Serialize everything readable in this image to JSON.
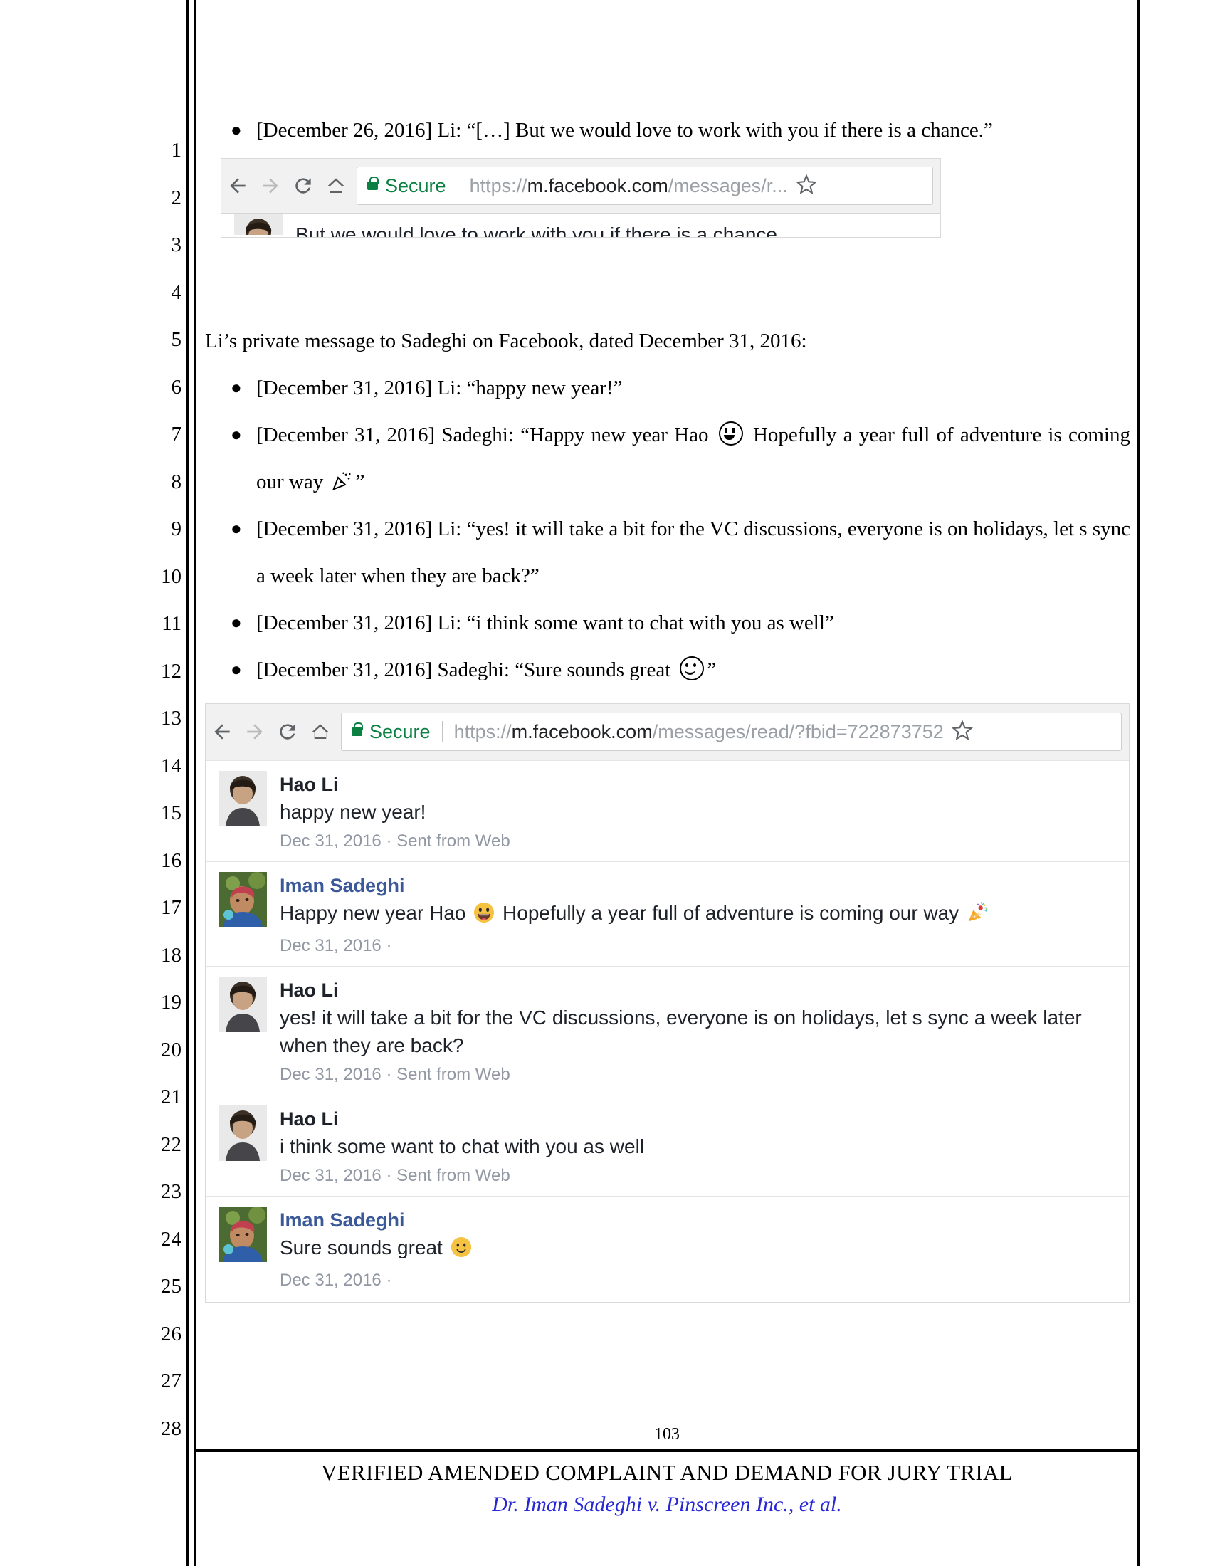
{
  "document": {
    "line_numbers": [
      "1",
      "2",
      "3",
      "4",
      "5",
      "6",
      "7",
      "8",
      "9",
      "10",
      "11",
      "12",
      "13",
      "14",
      "15",
      "16",
      "17",
      "18",
      "19",
      "20",
      "21",
      "22",
      "23",
      "24",
      "25",
      "26",
      "27",
      "28"
    ],
    "footer": {
      "page_number": "103",
      "title": "VERIFIED AMENDED COMPLAINT AND DEMAND FOR JURY TRIAL",
      "case_caption": "Dr. Iman Sadeghi v. Pinscreen Inc., et al."
    }
  },
  "body": {
    "bullet_dec26": "[December 26, 2016] Li: “[…] But we would love to work with you if there is a chance.”",
    "intro_paragraph": "Li’s private message to Sadeghi on Facebook, dated December 31, 2016:",
    "bullets": [
      {
        "pre": "[December 31, 2016] Li: “happy new year!”",
        "post": ""
      },
      {
        "pre": "[December 31, 2016] Sadeghi: “Happy new year Hao ",
        "mid": " Hopefully a year full of adventure is coming our way ",
        "post": "”"
      },
      {
        "pre": "[December 31, 2016] Li: “yes! it will take a bit for the VC discussions, everyone is on holidays, let s sync a week later when they are back?”",
        "post": ""
      },
      {
        "pre": "[December 31, 2016] Li: “i think some want to chat with you as well”",
        "post": ""
      },
      {
        "pre": "[December 31, 2016] Sadeghi: “Sure sounds great ",
        "post": "”"
      }
    ]
  },
  "screenshot_one": {
    "browser": {
      "back_icon": "back-arrow-icon",
      "forward_icon": "forward-arrow-icon",
      "reload_icon": "reload-icon",
      "home_icon": "home-icon",
      "lock_icon": "lock-icon",
      "secure_label": "Secure",
      "url_scheme": "https://",
      "url_host": "m.facebook.com",
      "url_path": "/messages/r...",
      "star_icon": "bookmark-star-icon"
    },
    "message_text": "But we would love to work with you if there is a chance."
  },
  "screenshot_two": {
    "browser": {
      "back_icon": "back-arrow-icon",
      "forward_icon": "forward-arrow-icon",
      "reload_icon": "reload-icon",
      "home_icon": "home-icon",
      "lock_icon": "lock-icon",
      "secure_label": "Secure",
      "url_scheme": "https://",
      "url_host": "m.facebook.com",
      "url_path": "/messages/read/?fbid=722873752",
      "star_icon": "bookmark-star-icon"
    },
    "messages": [
      {
        "name": "Hao Li",
        "is_self": false,
        "text": "happy new year!",
        "meta": "Dec 31, 2016 · Sent from Web"
      },
      {
        "name": "Iman Sadeghi",
        "is_self": true,
        "text_before": "Happy new year Hao ",
        "emoji_1": "grinning-face-emoji",
        "text_middle": " Hopefully a year full of adventure is coming our way ",
        "emoji_2": "party-popper-emoji",
        "meta": "Dec 31, 2016 ·"
      },
      {
        "name": "Hao Li",
        "is_self": false,
        "text": "yes! it will take a bit for the VC discussions, everyone is on holidays, let s sync a week later when they are back?",
        "meta": "Dec 31, 2016 · Sent from Web"
      },
      {
        "name": "Hao Li",
        "is_self": false,
        "text": "i think some want to chat with you as well",
        "meta": "Dec 31, 2016 · Sent from Web"
      },
      {
        "name": "Iman Sadeghi",
        "is_self": true,
        "text_before": "Sure sounds great ",
        "emoji_1": "slightly-smiling-face-emoji",
        "meta": "Dec 31, 2016 ·"
      }
    ]
  },
  "colors": {
    "secure_green": "#0b8043",
    "fb_blue": "#3b5998",
    "meta_gray": "#9197a3",
    "case_blue": "#2727d6"
  }
}
